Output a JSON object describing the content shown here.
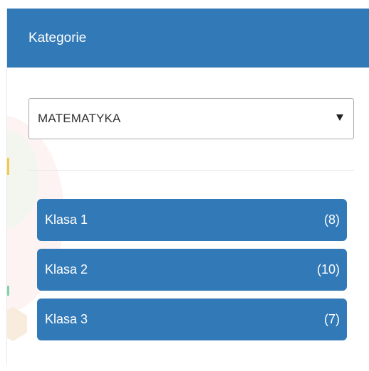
{
  "panel": {
    "title": "Kategorie"
  },
  "category_select": {
    "selected": "MATEMATYKA",
    "arrow_icon": "caret-down-icon"
  },
  "classes": [
    {
      "label": "Klasa 1",
      "count": "(8)"
    },
    {
      "label": "Klasa 2",
      "count": "(10)"
    },
    {
      "label": "Klasa 3",
      "count": "(7)"
    }
  ],
  "colors": {
    "accent": "#3279b7",
    "text_on_accent": "#ffffff"
  }
}
